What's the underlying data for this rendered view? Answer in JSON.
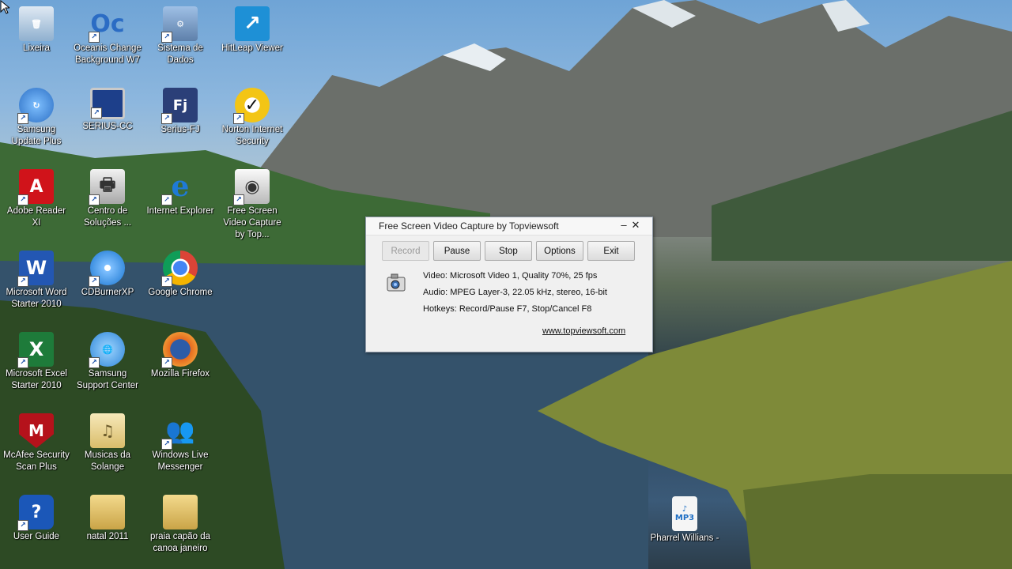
{
  "desktop": {
    "icons": [
      {
        "label": "Lixeira",
        "icon": "recycle-bin-icon",
        "color": "#a9c4da"
      },
      {
        "label": "Oceanis Change Background W7",
        "icon": "oceanis-icon",
        "color": "#2b6cc4"
      },
      {
        "label": "Sistema de Dados",
        "icon": "system-data-icon",
        "color": "#6d8fb5"
      },
      {
        "label": "HitLeap Viewer",
        "icon": "hitleap-icon",
        "color": "#1e90d6"
      },
      {
        "label": "Samsung Update Plus",
        "icon": "samsung-update-icon",
        "color": "#3d7fd0"
      },
      {
        "label": "SERIUS-CC",
        "icon": "monitor-icon",
        "color": "#1d3f8a"
      },
      {
        "label": "Serius-FJ",
        "icon": "serius-fj-icon",
        "color": "#2b3f78"
      },
      {
        "label": "Norton Internet Security",
        "icon": "norton-icon",
        "color": "#f3c515"
      },
      {
        "label": "Adobe Reader XI",
        "icon": "adobe-reader-icon",
        "color": "#d0131a"
      },
      {
        "label": "Centro de Soluções ...",
        "icon": "printer-icon",
        "color": "#c9c9c9"
      },
      {
        "label": "Internet Explorer",
        "icon": "internet-explorer-icon",
        "color": "#1f7ad6"
      },
      {
        "label": "Free Screen Video Capture by Top...",
        "icon": "camera-icon",
        "color": "#d8d8d8"
      },
      {
        "label": "Microsoft Word Starter 2010",
        "icon": "word-icon",
        "color": "#2357b3"
      },
      {
        "label": "CDBurnerXP",
        "icon": "cd-burner-icon",
        "color": "#3c8fe0"
      },
      {
        "label": "Google Chrome",
        "icon": "chrome-icon",
        "color": "#db4437"
      },
      {
        "label": "Microsoft Excel Starter 2010",
        "icon": "excel-icon",
        "color": "#1e7b3a"
      },
      {
        "label": "Samsung Support Center",
        "icon": "samsung-support-icon",
        "color": "#2e86d9"
      },
      {
        "label": "Mozilla Firefox",
        "icon": "firefox-icon",
        "color": "#e66a1f"
      },
      {
        "label": "McAfee Security Scan Plus",
        "icon": "mcafee-icon",
        "color": "#b5121b"
      },
      {
        "label": "Musicas da Solange",
        "icon": "music-folder-icon",
        "color": "#e8d49a"
      },
      {
        "label": "Windows Live Messenger",
        "icon": "messenger-icon",
        "color": "#4aa4e0"
      },
      {
        "label": "User Guide",
        "icon": "help-icon",
        "color": "#1b57b8"
      },
      {
        "label": "natal 2011",
        "icon": "folder-icon",
        "color": "#e6c66a"
      },
      {
        "label": "praia capão da canoa janeiro",
        "icon": "folder-icon",
        "color": "#e6c66a"
      },
      {
        "label": "Pharrel Willians -",
        "icon": "mp3-file-icon",
        "color": "#f5f5f5"
      }
    ]
  },
  "dialog": {
    "title": "Free Screen Video Capture by Topviewsoft",
    "minimize": "–",
    "close": "✕",
    "buttons": {
      "record": "Record",
      "pause": "Pause",
      "stop": "Stop",
      "options": "Options",
      "exit": "Exit"
    },
    "info": {
      "video": "Video: Microsoft Video 1, Quality 70%, 25 fps",
      "audio": "Audio: MPEG Layer-3, 22.05 kHz, stereo, 16-bit",
      "hotkeys": "Hotkeys: Record/Pause F7, Stop/Cancel F8"
    },
    "link": "www.topviewsoft.com"
  }
}
